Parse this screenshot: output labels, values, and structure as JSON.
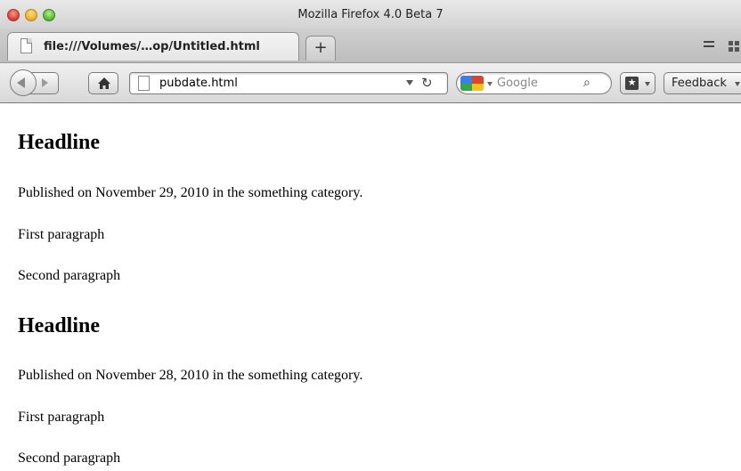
{
  "window": {
    "title": "Mozilla Firefox 4.0 Beta 7"
  },
  "tab": {
    "label": "file:///Volumes/…op/Untitled.html",
    "new_tab_label": "+"
  },
  "navbar": {
    "url": "pubdate.html",
    "search_placeholder": "Google",
    "feedback_label": "Feedback"
  },
  "posts": [
    {
      "headline": "Headline",
      "published": "Published on November 29, 2010 in the something category.",
      "paragraphs": [
        "First paragraph",
        "Second paragraph"
      ]
    },
    {
      "headline": "Headline",
      "published": "Published on November 28, 2010 in the something category.",
      "paragraphs": [
        "First paragraph",
        "Second paragraph"
      ]
    }
  ]
}
